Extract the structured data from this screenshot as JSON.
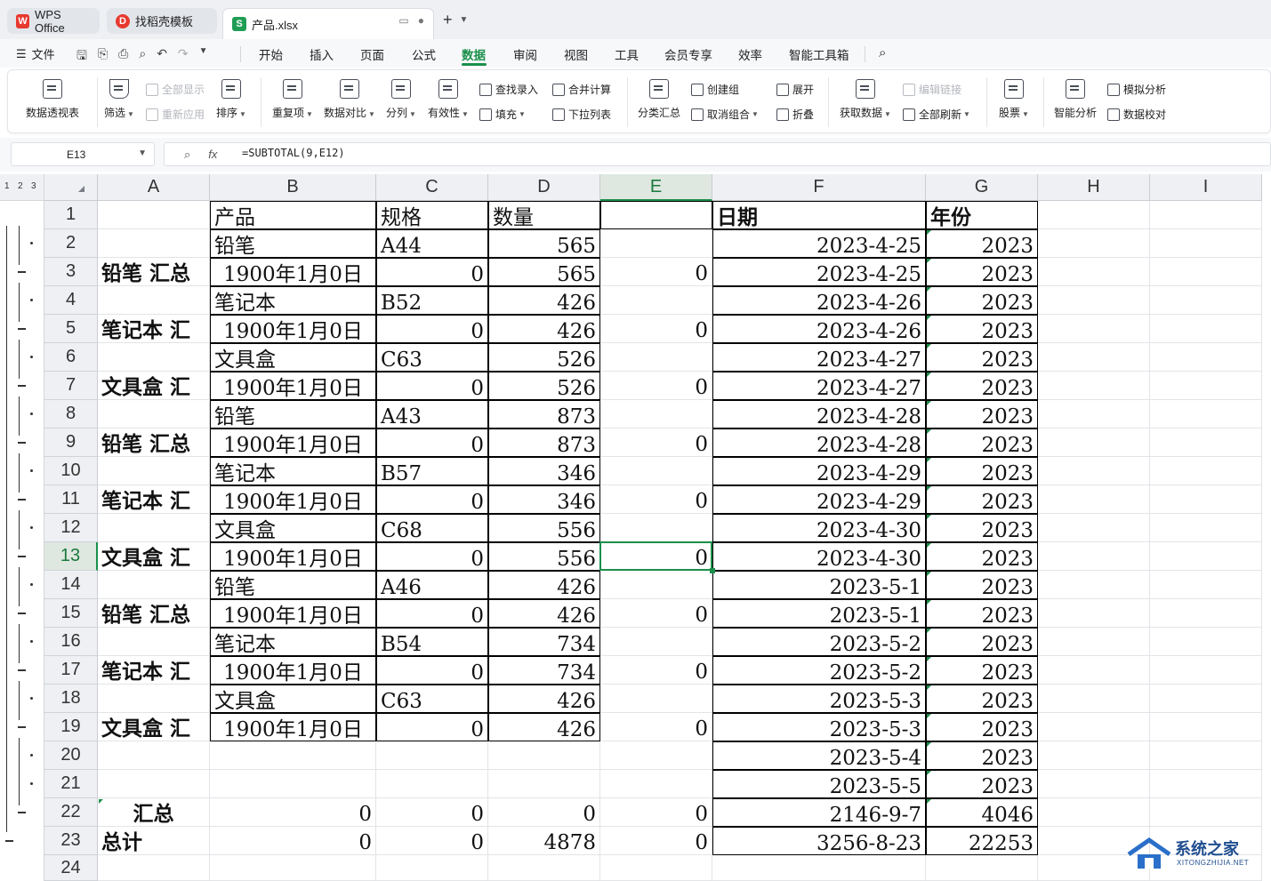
{
  "titlebar": {
    "tabs": [
      {
        "label": "WPS Office"
      },
      {
        "label": "找稻壳模板"
      },
      {
        "label": "产品.xlsx"
      }
    ]
  },
  "menubar": {
    "file_label": "文件",
    "items": [
      "开始",
      "插入",
      "页面",
      "公式",
      "数据",
      "审阅",
      "视图",
      "工具",
      "会员专享",
      "效率",
      "智能工具箱"
    ],
    "active": "数据"
  },
  "ribbon": {
    "pivot": "数据透视表",
    "filter": "筛选",
    "show_all": "全部显示",
    "reapply": "重新应用",
    "sort": "排序",
    "duplicates": "重复项",
    "compare": "数据对比",
    "split": "分列",
    "validity": "有效性",
    "lookup": "查找录入",
    "fill": "填充",
    "consolidate": "合并计算",
    "dropdown": "下拉列表",
    "subtotal": "分类汇总",
    "create_group": "创建组",
    "ungroup": "取消组合",
    "expand": "展开",
    "collapse": "折叠",
    "get_data": "获取数据",
    "edit_links": "编辑链接",
    "refresh_all": "全部刷新",
    "stocks": "股票",
    "smart_analysis": "智能分析",
    "whatif": "模拟分析",
    "verify": "数据校对"
  },
  "formula_bar": {
    "name_box": "E13",
    "formula": "=SUBTOTAL(9,E12)"
  },
  "outline_levels": [
    "1",
    "2",
    "3"
  ],
  "columns": [
    "A",
    "B",
    "C",
    "D",
    "E",
    "F",
    "G",
    "H",
    "I"
  ],
  "rows": [
    {
      "n": "1",
      "A": "",
      "B": "产品",
      "C": "规格",
      "D": "数量",
      "E": "",
      "F": "日期",
      "G": "年份"
    },
    {
      "n": "2",
      "A": "",
      "B": "铅笔",
      "C": "A44",
      "D": "565",
      "E": "",
      "F": "2023-4-25",
      "G": "2023"
    },
    {
      "n": "3",
      "A": "铅笔 汇总",
      "B": "1900年1月0日",
      "C": "0",
      "D": "565",
      "E": "0",
      "F": "2023-4-25",
      "G": "2023"
    },
    {
      "n": "4",
      "A": "",
      "B": "笔记本",
      "C": "B52",
      "D": "426",
      "E": "",
      "F": "2023-4-26",
      "G": "2023"
    },
    {
      "n": "5",
      "A": "笔记本 汇",
      "B": "1900年1月0日",
      "C": "0",
      "D": "426",
      "E": "0",
      "F": "2023-4-26",
      "G": "2023"
    },
    {
      "n": "6",
      "A": "",
      "B": "文具盒",
      "C": "C63",
      "D": "526",
      "E": "",
      "F": "2023-4-27",
      "G": "2023"
    },
    {
      "n": "7",
      "A": "文具盒 汇",
      "B": "1900年1月0日",
      "C": "0",
      "D": "526",
      "E": "0",
      "F": "2023-4-27",
      "G": "2023"
    },
    {
      "n": "8",
      "A": "",
      "B": "铅笔",
      "C": "A43",
      "D": "873",
      "E": "",
      "F": "2023-4-28",
      "G": "2023"
    },
    {
      "n": "9",
      "A": "铅笔 汇总",
      "B": "1900年1月0日",
      "C": "0",
      "D": "873",
      "E": "0",
      "F": "2023-4-28",
      "G": "2023"
    },
    {
      "n": "10",
      "A": "",
      "B": "笔记本",
      "C": "B57",
      "D": "346",
      "E": "",
      "F": "2023-4-29",
      "G": "2023"
    },
    {
      "n": "11",
      "A": "笔记本 汇",
      "B": "1900年1月0日",
      "C": "0",
      "D": "346",
      "E": "0",
      "F": "2023-4-29",
      "G": "2023"
    },
    {
      "n": "12",
      "A": "",
      "B": "文具盒",
      "C": "C68",
      "D": "556",
      "E": "",
      "F": "2023-4-30",
      "G": "2023"
    },
    {
      "n": "13",
      "A": "文具盒 汇",
      "B": "1900年1月0日",
      "C": "0",
      "D": "556",
      "E": "0",
      "F": "2023-4-30",
      "G": "2023"
    },
    {
      "n": "14",
      "A": "",
      "B": "铅笔",
      "C": "A46",
      "D": "426",
      "E": "",
      "F": "2023-5-1",
      "G": "2023"
    },
    {
      "n": "15",
      "A": "铅笔 汇总",
      "B": "1900年1月0日",
      "C": "0",
      "D": "426",
      "E": "0",
      "F": "2023-5-1",
      "G": "2023"
    },
    {
      "n": "16",
      "A": "",
      "B": "笔记本",
      "C": "B54",
      "D": "734",
      "E": "",
      "F": "2023-5-2",
      "G": "2023"
    },
    {
      "n": "17",
      "A": "笔记本 汇",
      "B": "1900年1月0日",
      "C": "0",
      "D": "734",
      "E": "0",
      "F": "2023-5-2",
      "G": "2023"
    },
    {
      "n": "18",
      "A": "",
      "B": "文具盒",
      "C": "C63",
      "D": "426",
      "E": "",
      "F": "2023-5-3",
      "G": "2023"
    },
    {
      "n": "19",
      "A": "文具盒 汇",
      "B": "1900年1月0日",
      "C": "0",
      "D": "426",
      "E": "0",
      "F": "2023-5-3",
      "G": "2023"
    },
    {
      "n": "20",
      "A": "",
      "B": "",
      "C": "",
      "D": "",
      "E": "",
      "F": "2023-5-4",
      "G": "2023"
    },
    {
      "n": "21",
      "A": "",
      "B": "",
      "C": "",
      "D": "",
      "E": "",
      "F": "2023-5-5",
      "G": "2023"
    },
    {
      "n": "22",
      "A": "汇总",
      "B": "0",
      "C": "0",
      "D": "0",
      "E": "0",
      "F": "2146-9-7",
      "G": "4046"
    },
    {
      "n": "23",
      "A": "总计",
      "B": "0",
      "C": "0",
      "D": "4878",
      "E": "0",
      "F": "3256-8-23",
      "G": "22253"
    },
    {
      "n": "24",
      "A": "",
      "B": "",
      "C": "",
      "D": "",
      "E": "",
      "F": "",
      "G": ""
    }
  ],
  "selected_cell": {
    "col": "E",
    "row": "13"
  },
  "watermark": {
    "title": "系统之家",
    "url": "XITONGZHIJIA.NET"
  },
  "colors": {
    "accent": "#1a8f4a",
    "wps_red": "#e8392f",
    "sheet_green": "#1f9d55"
  }
}
